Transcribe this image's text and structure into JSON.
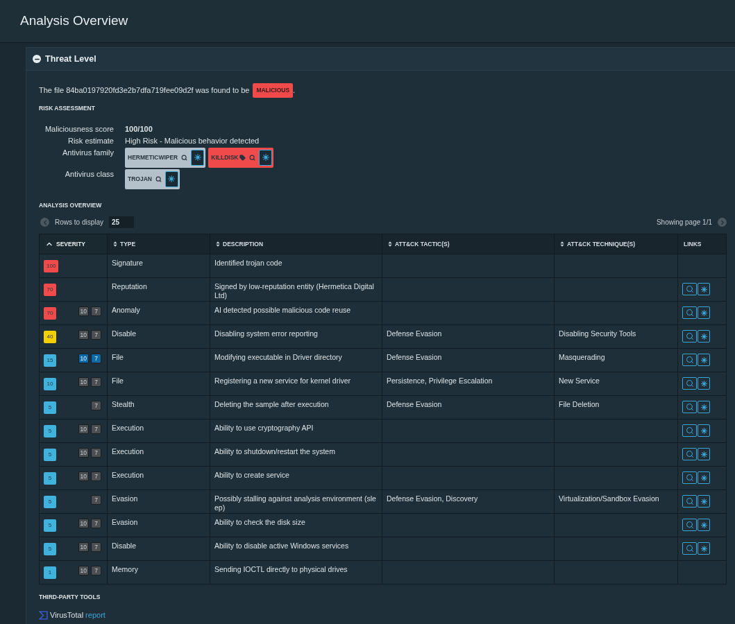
{
  "page_title": "Analysis Overview",
  "panel": {
    "title": "Threat Level",
    "expanded": true
  },
  "verdict": {
    "prefix": "The file 84ba0197920fd3e2b7dfa719fee09d2f was found to be",
    "badge": "MALICIOUS",
    "suffix": "."
  },
  "risk_heading": "RISK ASSESSMENT",
  "risk": [
    {
      "kind": "text",
      "label": "Maliciousness score",
      "value": "100/100",
      "bold": true
    },
    {
      "kind": "text",
      "label": "Risk estimate",
      "value": "High Risk - Malicious behavior detected",
      "bold": false
    },
    {
      "kind": "chips",
      "label": "Antivirus family",
      "chips": [
        {
          "label": "HERMETICWIPER",
          "color": "#b5c1ca",
          "tagged": false
        },
        {
          "label": "KILLDISK",
          "color": "#f04a4b",
          "tagged": true
        }
      ]
    },
    {
      "kind": "chips",
      "label": "Antivirus class",
      "chips": [
        {
          "label": "TROJAN",
          "color": "#b5c1ca",
          "tagged": false
        }
      ]
    }
  ],
  "overview_heading": "ANALYSIS OVERVIEW",
  "pager": {
    "rows_label": "Rows to display",
    "rows_value": "25",
    "page_text": "Showing page 1/1"
  },
  "table": {
    "columns": [
      {
        "label": "SEVERITY",
        "sortable": true,
        "sorted": true
      },
      {
        "label": "TYPE",
        "sortable": true,
        "sorted": false
      },
      {
        "label": "DESCRIPTION",
        "sortable": true,
        "sorted": false
      },
      {
        "label": "ATT&CK TACTIC(S)",
        "sortable": true,
        "sorted": false
      },
      {
        "label": "ATT&CK TECHNIQUE(S)",
        "sortable": true,
        "sorted": false
      },
      {
        "label": "LINKS",
        "sortable": false,
        "sorted": false
      }
    ],
    "rows": [
      {
        "score": "100",
        "color": "#f04a4b",
        "tags": [],
        "type": "Signature",
        "description": "Identified trojan code",
        "tactic": "",
        "technique": "",
        "links": false
      },
      {
        "score": "70",
        "color": "#f04a4b",
        "tags": [],
        "type": "Reputation",
        "description": "Signed by low-reputation entity (Hermetica Digital Ltd)",
        "tactic": "",
        "technique": "",
        "links": true
      },
      {
        "score": "70",
        "color": "#f04a4b",
        "tags": [
          {
            "label": "10",
            "highlighted": false
          },
          {
            "label": "7",
            "highlighted": false
          }
        ],
        "type": "Anomaly",
        "description": "AI detected possible malicious code reuse",
        "tactic": "",
        "technique": "",
        "links": true
      },
      {
        "score": "40",
        "color": "#f5d000",
        "tags": [
          {
            "label": "10",
            "highlighted": false
          },
          {
            "label": "7",
            "highlighted": false
          }
        ],
        "type": "Disable",
        "description": "Disabling system error reporting",
        "tactic": "Defense Evasion",
        "technique": "Disabling Security Tools",
        "links": true
      },
      {
        "score": "15",
        "color": "#3fb2de",
        "tags": [
          {
            "label": "10",
            "highlighted": true
          },
          {
            "label": "7",
            "highlighted": true
          }
        ],
        "type": "File",
        "description": "Modifying executable in Driver directory",
        "tactic": "Defense Evasion",
        "technique": "Masquerading",
        "links": true
      },
      {
        "score": "10",
        "color": "#3fb2de",
        "tags": [
          {
            "label": "10",
            "highlighted": false
          },
          {
            "label": "7",
            "highlighted": false
          }
        ],
        "type": "File",
        "description": "Registering a new service for kernel driver",
        "tactic": "Persistence, Privilege Escalation",
        "technique": "New Service",
        "links": true
      },
      {
        "score": "5",
        "color": "#3fb2de",
        "tags": [
          {
            "label": "7",
            "highlighted": false
          }
        ],
        "type": "Stealth",
        "description": "Deleting the sample after execution",
        "tactic": "Defense Evasion",
        "technique": "File Deletion",
        "links": true
      },
      {
        "score": "5",
        "color": "#3fb2de",
        "tags": [
          {
            "label": "10",
            "highlighted": false
          },
          {
            "label": "7",
            "highlighted": false
          }
        ],
        "type": "Execution",
        "description": "Ability to use cryptography API",
        "tactic": "",
        "technique": "",
        "links": true
      },
      {
        "score": "5",
        "color": "#3fb2de",
        "tags": [
          {
            "label": "10",
            "highlighted": false
          },
          {
            "label": "7",
            "highlighted": false
          }
        ],
        "type": "Execution",
        "description": "Ability to shutdown/restart the system",
        "tactic": "",
        "technique": "",
        "links": true
      },
      {
        "score": "5",
        "color": "#3fb2de",
        "tags": [
          {
            "label": "10",
            "highlighted": false
          },
          {
            "label": "7",
            "highlighted": false
          }
        ],
        "type": "Execution",
        "description": "Ability to create service",
        "tactic": "",
        "technique": "",
        "links": true
      },
      {
        "score": "5",
        "color": "#3fb2de",
        "tags": [
          {
            "label": "7",
            "highlighted": false
          }
        ],
        "type": "Evasion",
        "description": "Possibly stalling against analysis environment (sleep)",
        "tactic": "Defense Evasion, Discovery",
        "technique": "Virtualization/Sandbox Evasion",
        "links": true
      },
      {
        "score": "5",
        "color": "#3fb2de",
        "tags": [
          {
            "label": "10",
            "highlighted": false
          },
          {
            "label": "7",
            "highlighted": false
          }
        ],
        "type": "Evasion",
        "description": "Ability to check the disk size",
        "tactic": "",
        "technique": "",
        "links": true
      },
      {
        "score": "5",
        "color": "#3fb2de",
        "tags": [
          {
            "label": "10",
            "highlighted": false
          },
          {
            "label": "7",
            "highlighted": false
          }
        ],
        "type": "Disable",
        "description": "Ability to disable active Windows services",
        "tactic": "",
        "technique": "",
        "links": true
      },
      {
        "score": "1",
        "color": "#3fb2de",
        "tags": [
          {
            "label": "10",
            "highlighted": false
          },
          {
            "label": "7",
            "highlighted": false
          }
        ],
        "type": "Memory",
        "description": "Sending IOCTL directly to physical drives",
        "tactic": "",
        "technique": "",
        "links": false
      }
    ]
  },
  "third_party": {
    "heading": "THIRD-PARTY TOOLS",
    "tool": "VirusTotal",
    "link": "report"
  }
}
